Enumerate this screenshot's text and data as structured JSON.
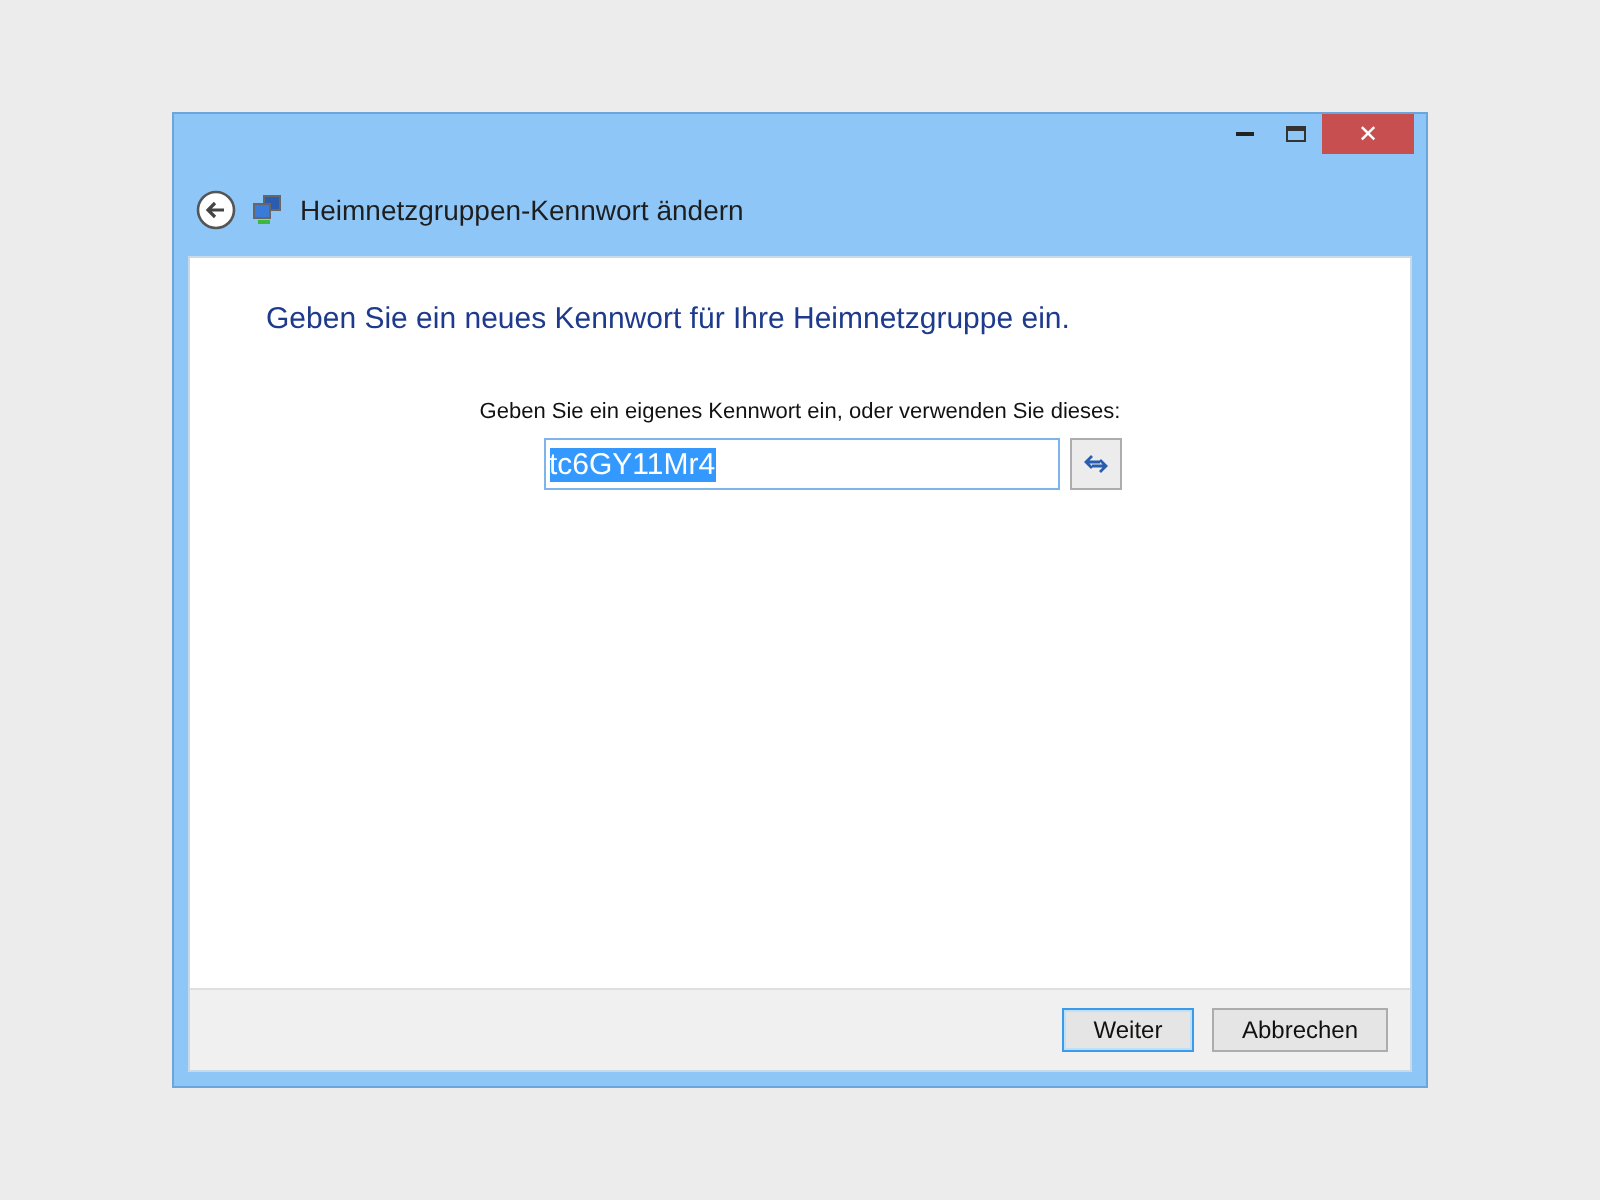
{
  "window": {
    "title": "Heimnetzgruppen-Kennwort ändern",
    "close_glyph": "✕"
  },
  "heading": "Geben Sie ein neues Kennwort für Ihre Heimnetzgruppe ein.",
  "password": {
    "label": "Geben Sie ein eigenes Kennwort ein, oder verwenden Sie dieses:",
    "value": "tc6GY11Mr4",
    "text_selected": true
  },
  "buttons": [
    {
      "label": "Weiter",
      "default": true
    },
    {
      "label": "Abbrechen",
      "default": false
    }
  ]
}
